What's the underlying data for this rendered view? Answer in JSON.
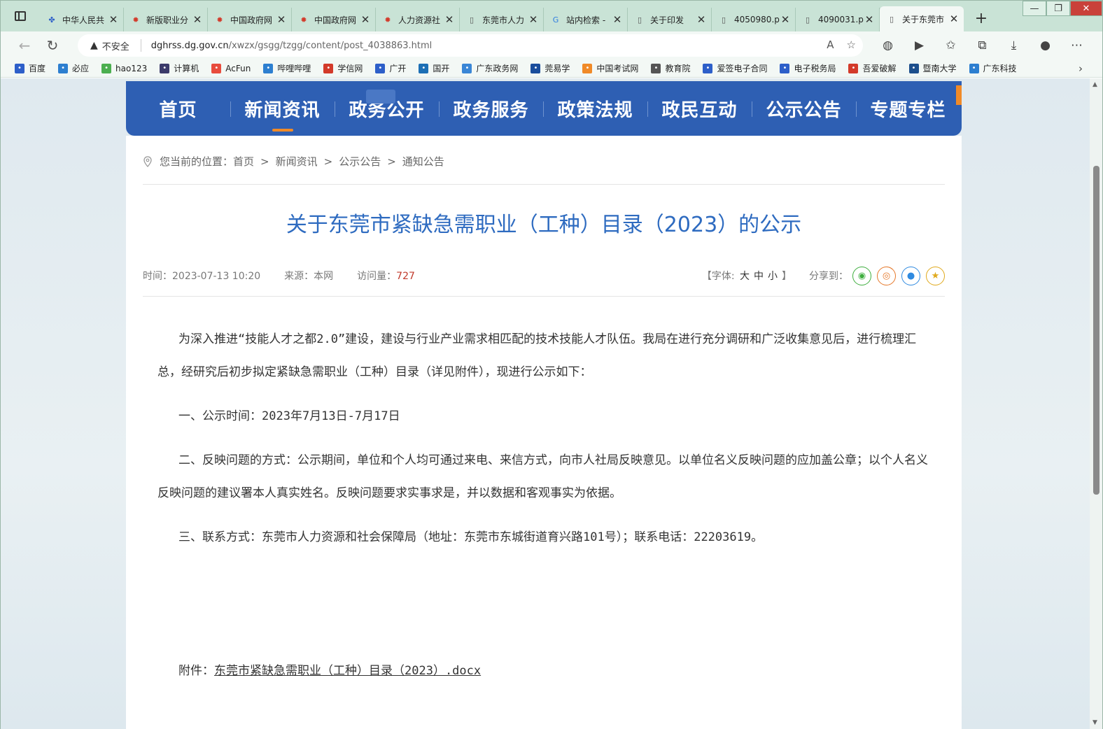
{
  "browser": {
    "tabs": [
      {
        "title": "中华人民共",
        "icon": "paw-icon",
        "color": "#2d5fc9"
      },
      {
        "title": "新版职业分",
        "icon": "emblem-icon",
        "color": "#d33a2a"
      },
      {
        "title": "中国政府网",
        "icon": "emblem-icon",
        "color": "#d33a2a"
      },
      {
        "title": "中国政府网",
        "icon": "emblem-icon",
        "color": "#d33a2a"
      },
      {
        "title": "人力资源社",
        "icon": "emblem-icon",
        "color": "#d33a2a"
      },
      {
        "title": "东莞市人力",
        "icon": "page-icon",
        "color": "#555555"
      },
      {
        "title": "站内检索 -",
        "icon": "g-icon",
        "color": "#2f7de0"
      },
      {
        "title": "关于印发",
        "icon": "page-icon",
        "color": "#555555"
      },
      {
        "title": "4050980.p",
        "icon": "page-icon",
        "color": "#555555"
      },
      {
        "title": "4090031.p",
        "icon": "page-icon",
        "color": "#555555"
      },
      {
        "title": "关于东莞市",
        "icon": "page-icon",
        "color": "#555555",
        "active": true
      }
    ],
    "insecure_label": "不安全",
    "url_host": "dghrss.dg.gov.cn",
    "url_path": "/xwzx/gsgg/tzgg/content/post_4038863.html",
    "bookmarks": [
      {
        "label": "百度",
        "color": "#2d5fc9"
      },
      {
        "label": "必应",
        "color": "#2d7fd0"
      },
      {
        "label": "hao123",
        "color": "#4caf50"
      },
      {
        "label": "计算机",
        "color": "#3b3b6b"
      },
      {
        "label": "AcFun",
        "color": "#e84c3d"
      },
      {
        "label": "哔哩哔哩",
        "color": "#2d7fd0"
      },
      {
        "label": "学信网",
        "color": "#d33a2a"
      },
      {
        "label": "广开",
        "color": "#2d5fc9"
      },
      {
        "label": "国开",
        "color": "#1c6fb5"
      },
      {
        "label": "广东政务网",
        "color": "#3a86d6"
      },
      {
        "label": "莞易学",
        "color": "#1a4d9c"
      },
      {
        "label": "中国考试网",
        "color": "#f08a28"
      },
      {
        "label": "教育院",
        "color": "#555555"
      },
      {
        "label": "爱签电子合同",
        "color": "#2d5fc9"
      },
      {
        "label": "电子税务局",
        "color": "#2d5fc9"
      },
      {
        "label": "吾爱破解",
        "color": "#d33a2a"
      },
      {
        "label": "暨南大学",
        "color": "#1c4f8c"
      },
      {
        "label": "广东科技",
        "color": "#2d7fd0"
      }
    ]
  },
  "site": {
    "nav": [
      "首页",
      "新闻资讯",
      "政务公开",
      "政务服务",
      "政策法规",
      "政民互动",
      "公示公告",
      "专题专栏"
    ],
    "breadcrumb": {
      "prefix": "您当前的位置：",
      "items": [
        "首页",
        "新闻资讯",
        "公示公告",
        "通知公告"
      ]
    }
  },
  "article": {
    "title": "关于东莞市紧缺急需职业（工种）目录（2023）的公示",
    "time": "时间：2023-07-13 10:20",
    "source": "来源：本网",
    "views_label": "访问量：",
    "views": "727",
    "font_size_label_open": "【字体:",
    "font_sizes": [
      "大",
      "中",
      "小"
    ],
    "font_size_label_close": "】",
    "share_label": "分享到：",
    "share": [
      {
        "name": "wechat-share-icon",
        "color": "#3fae3f",
        "glyph": "◉"
      },
      {
        "name": "weibo-share-icon",
        "color": "#e6792b",
        "glyph": "◎"
      },
      {
        "name": "qq-share-icon",
        "color": "#2f8ae0",
        "glyph": "●"
      },
      {
        "name": "qzone-share-icon",
        "color": "#e0a91c",
        "glyph": "★"
      }
    ],
    "paragraphs": [
      "为深入推进“技能人才之都2.0”建设，建设与行业产业需求相匹配的技术技能人才队伍。我局在进行充分调研和广泛收集意见后，进行梳理汇总，经研究后初步拟定紧缺急需职业（工种）目录（详见附件），现进行公示如下：",
      "一、公示时间：2023年7月13日-7月17日",
      "二、反映问题的方式：公示期间，单位和个人均可通过来电、来信方式，向市人社局反映意见。以单位名义反映问题的应加盖公章；以个人名义反映问题的建议署本人真实姓名。反映问题要求实事求是，并以数据和客观事实为依据。",
      "三、联系方式：东莞市人力资源和社会保障局（地址：东莞市东城街道育兴路101号）；联系电话：22203619。"
    ],
    "attachment_label": "附件：",
    "attachment_link": "东莞市紧缺急需职业（工种）目录（2023）.docx"
  }
}
